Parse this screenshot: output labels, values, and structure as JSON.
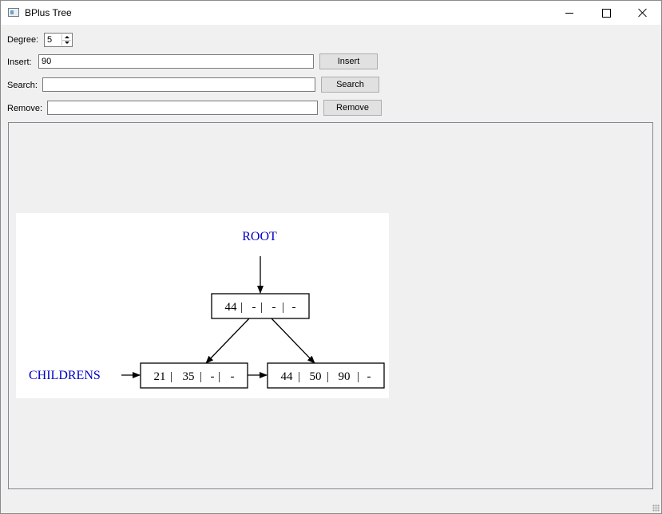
{
  "window": {
    "title": "BPlus Tree",
    "icon": "app-window-icon"
  },
  "controls": {
    "degree": {
      "label": "Degree:",
      "value": "5"
    },
    "insert": {
      "label": "Insert:",
      "value": "90",
      "button": "Insert"
    },
    "search": {
      "label": "Search:",
      "value": "",
      "button": "Search"
    },
    "remove": {
      "label": "Remove:",
      "value": "",
      "button": "Remove"
    }
  },
  "tree": {
    "root_label": "ROOT",
    "children_label": "CHILDRENS",
    "root_node": [
      "44",
      "-",
      "-",
      "-"
    ],
    "leaves": [
      [
        "21",
        "35",
        "-",
        "-"
      ],
      [
        "44",
        "50",
        "90",
        "-"
      ]
    ],
    "label_color": "#0000c0"
  }
}
